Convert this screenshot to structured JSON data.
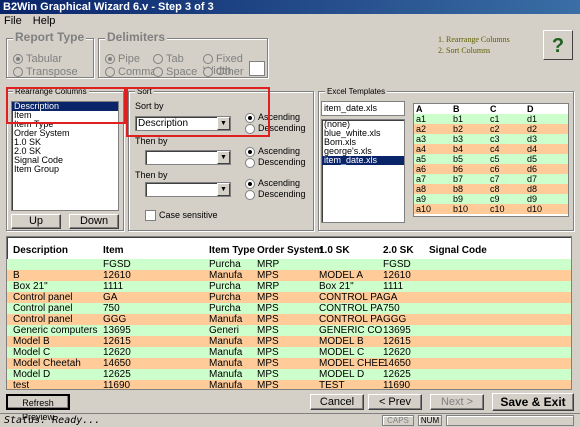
{
  "window": {
    "title": "B2Win Graphical Wizard 6.v - Step 3 of 3"
  },
  "menu": [
    "File",
    "Help"
  ],
  "report_type": {
    "title": "Report Type",
    "options": [
      {
        "label": "Tabular",
        "selected": true
      },
      {
        "label": "Transpose",
        "selected": false
      }
    ]
  },
  "delimiters": {
    "title": "Delimiters",
    "options": [
      {
        "label": "Pipe",
        "selected": true
      },
      {
        "label": "Comma",
        "selected": false
      },
      {
        "label": "Tab",
        "selected": false
      },
      {
        "label": "Space",
        "selected": false
      },
      {
        "label": "Fixed Width",
        "selected": false
      },
      {
        "label": "Other",
        "selected": false
      }
    ]
  },
  "steps": [
    "1. Rearrange Columns",
    "2. Sort Columns"
  ],
  "help_button": "?",
  "rearrange": {
    "title": "Rearrange Columns",
    "items": [
      "Description",
      "Item",
      "Item Type",
      "Order System",
      "1.0 SK",
      "2.0 SK",
      "Signal Code",
      "Item Group"
    ],
    "selected_index": 0,
    "up_label": "Up",
    "down_label": "Down"
  },
  "sort": {
    "title": "Sort",
    "sort_by_label": "Sort by",
    "sort_by_value": "Description",
    "then_by_label_1": "Then by",
    "then_by_label_2": "Then by",
    "ascending_label": "Ascending",
    "descending_label": "Descending",
    "case_sensitive_label": "Case sensitive"
  },
  "excel_templates": {
    "title": "Excel Templates",
    "filename": "item_date.xls",
    "files": [
      "(none)",
      "blue_white.xls",
      "Bom.xls",
      "george's.xls",
      "item_date.xls"
    ],
    "selected_file": 4,
    "headers": [
      "A",
      "B",
      "C",
      "D"
    ],
    "rows": [
      [
        "a1",
        "b1",
        "c1",
        "d1"
      ],
      [
        "a2",
        "b2",
        "c2",
        "d2"
      ],
      [
        "a3",
        "b3",
        "c3",
        "d3"
      ],
      [
        "a4",
        "b4",
        "c4",
        "d4"
      ],
      [
        "a5",
        "b5",
        "c5",
        "d5"
      ],
      [
        "a6",
        "b6",
        "c6",
        "d6"
      ],
      [
        "a7",
        "b7",
        "c7",
        "d7"
      ],
      [
        "a8",
        "b8",
        "c8",
        "d8"
      ],
      [
        "a9",
        "b9",
        "c9",
        "d9"
      ],
      [
        "a10",
        "b10",
        "c10",
        "d10"
      ]
    ]
  },
  "preview": {
    "headers": [
      "Description",
      "Item",
      "Item Type",
      "Order System",
      "1.0 SK",
      "2.0 SK",
      "Signal Code"
    ],
    "rows": [
      {
        "c": [
          "",
          "FGSD",
          "Purcha",
          "MRP",
          "",
          "FGSD",
          ""
        ],
        "color": "g"
      },
      {
        "c": [
          "B",
          "12610",
          "Manufa",
          "MPS",
          "MODEL A",
          "12610",
          ""
        ],
        "color": "o"
      },
      {
        "c": [
          "Box 21\"",
          "1111",
          "Purcha",
          "MRP",
          "Box 21\"",
          "1111",
          ""
        ],
        "color": "g"
      },
      {
        "c": [
          "Control panel",
          "GA",
          "Purcha",
          "MPS",
          "CONTROL PA",
          "GA",
          ""
        ],
        "color": "o"
      },
      {
        "c": [
          "Control panel",
          "750",
          "Purcha",
          "MPS",
          "CONTROL PA",
          "750",
          ""
        ],
        "color": "g"
      },
      {
        "c": [
          "Control panel",
          "GGG",
          "Manufa",
          "MPS",
          "CONTROL PA",
          "GGG",
          ""
        ],
        "color": "o"
      },
      {
        "c": [
          "Generic computers",
          "13695",
          "Generi",
          "MPS",
          "GENERIC CO",
          "13695",
          ""
        ],
        "color": "g"
      },
      {
        "c": [
          "Model B",
          "12615",
          "Manufa",
          "MPS",
          "MODEL B",
          "12615",
          ""
        ],
        "color": "o"
      },
      {
        "c": [
          "Model C",
          "12620",
          "Manufa",
          "MPS",
          "MODEL C",
          "12620",
          ""
        ],
        "color": "g"
      },
      {
        "c": [
          "Model Cheetah",
          "14650",
          "Manufa",
          "MPS",
          "MODEL CHEE",
          "14650",
          ""
        ],
        "color": "o"
      },
      {
        "c": [
          "Model D",
          "12625",
          "Manufa",
          "MPS",
          "MODEL D",
          "12625",
          ""
        ],
        "color": "g"
      },
      {
        "c": [
          "test",
          "11690",
          "Manufa",
          "MPS",
          "TEST",
          "11690",
          ""
        ],
        "color": "o"
      }
    ]
  },
  "buttons": {
    "refresh": "Refresh Preview",
    "cancel": "Cancel",
    "prev": "< Prev",
    "next": "Next >",
    "save_exit": "Save & Exit"
  },
  "status": {
    "text": "Status: Ready...",
    "caps": "CAPS",
    "num": "NUM"
  }
}
